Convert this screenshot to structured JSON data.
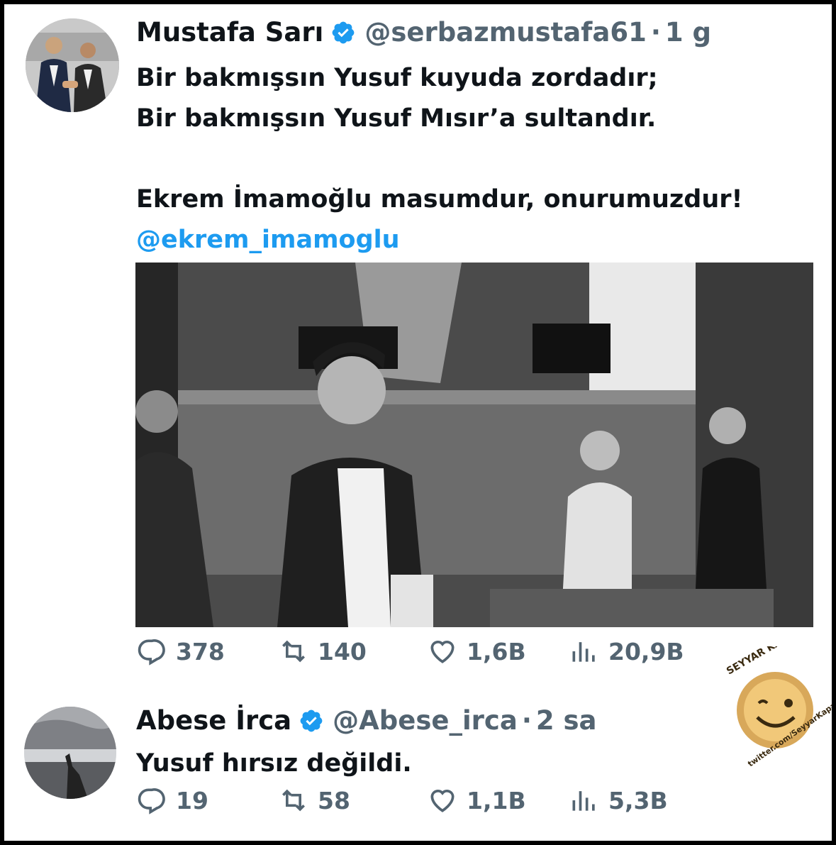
{
  "tweet1": {
    "name": "Mustafa Sarı",
    "handle": "@serbazmustafa61",
    "dot": "·",
    "time": "1 g",
    "line1": "Bir bakmışsın Yusuf kuyuda zordadır;",
    "line2": "Bir bakmışsın Yusuf Mısır’a sultandır.",
    "line3": "Ekrem İmamoğlu masumdur, onurumuzdur!",
    "mention": "@ekrem_imamoglu",
    "replies": "378",
    "reposts": "140",
    "likes": "1,6B",
    "views": "20,9B"
  },
  "tweet2": {
    "name": "Abese İrca",
    "handle": "@Abese_irca",
    "dot": "·",
    "time": "2 sa",
    "text": "Yusuf hırsız değildi.",
    "replies": "19",
    "reposts": "58",
    "likes": "1,1B",
    "views": "5,3B"
  },
  "watermark": {
    "top_text": "SEYYAR KAPAKÇI",
    "bottom_text": "twitter.com/SeyyarKapakci"
  },
  "colors": {
    "verified": "#1d9bf0",
    "text": "#0f1419",
    "muted": "#536471",
    "link": "#1d9bf0"
  }
}
